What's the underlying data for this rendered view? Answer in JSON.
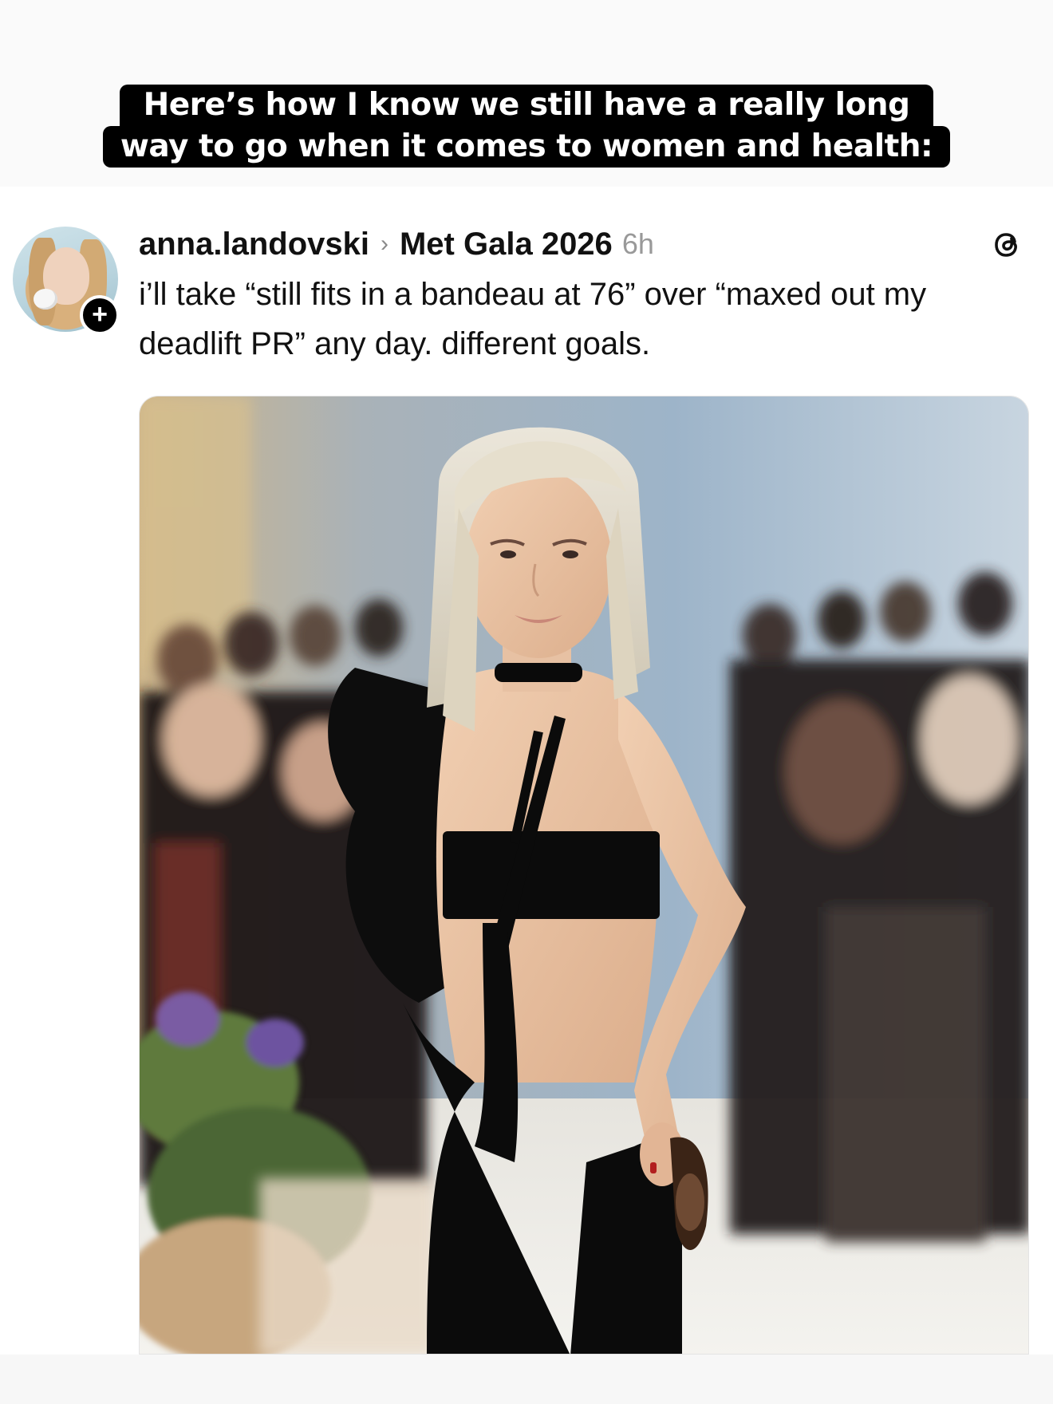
{
  "caption": {
    "line1": "Here’s how I know we still have a really long",
    "line2": "way to go when it comes to women and health:"
  },
  "post": {
    "username": "anna.landovski",
    "separator": "›",
    "topic": "Met Gala 2026",
    "time": "6h",
    "follow_symbol": "+",
    "text": "i’ll take “still fits in a bandeau at 76” over “maxed out my deadlift PR” any day. different goals.",
    "brand_icon": "threads-icon"
  },
  "colors": {
    "caption_bg": "#000000",
    "caption_text": "#ffffff",
    "text_primary": "#111111",
    "text_secondary": "#999999"
  }
}
